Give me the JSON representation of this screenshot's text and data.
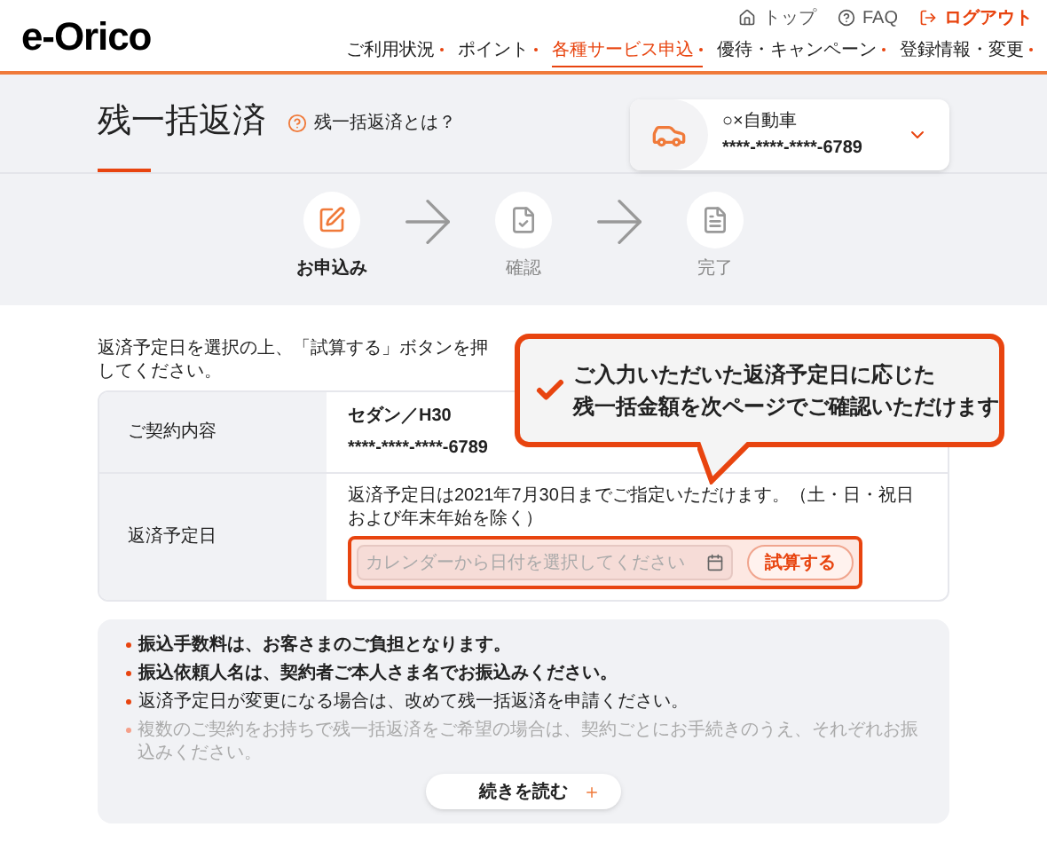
{
  "header": {
    "logo": "e-Orico",
    "utility_links": [
      {
        "kind": "home",
        "label": "トップ"
      },
      {
        "kind": "help",
        "label": "FAQ"
      },
      {
        "kind": "logout",
        "label": "ログアウト"
      }
    ],
    "nav": [
      {
        "label": "ご利用状況",
        "selected": false
      },
      {
        "label": "ポイント",
        "selected": false
      },
      {
        "label": "各種サービス申込",
        "selected": true
      },
      {
        "label": "優待・キャンペーン",
        "selected": false
      },
      {
        "label": "登録情報・変更",
        "selected": false
      }
    ]
  },
  "hero": {
    "title": "残一括返済",
    "help_link": "残一括返済とは？",
    "card": {
      "name": "○×自動車",
      "number": "****-****-****-6789"
    }
  },
  "steps": [
    {
      "label": "お申込み",
      "kind": "apply",
      "selected": true
    },
    {
      "label": "確認",
      "kind": "confirm",
      "selected": false
    },
    {
      "label": "完了",
      "kind": "done",
      "selected": false
    }
  ],
  "instruction": "返済予定日を選択の上、「試算する」ボタンを押してください。",
  "callout": {
    "lines": [
      "ご入力いただいた返済予定日に応じた",
      "残一括金額を次ページでご確認いただけます"
    ]
  },
  "table": {
    "rows": [
      {
        "kind": "contract",
        "label": "ご契約内容",
        "lines": [
          "セダン／H30",
          "****-****-****-6789"
        ]
      },
      {
        "kind": "date",
        "label": "返済予定日",
        "note": "返済予定日は2021年7月30日までご指定いただけます。（土・日・祝日および年末年始を除く）",
        "placeholder": "カレンダーから日付を選択してください",
        "button": "試算する"
      }
    ]
  },
  "notes": {
    "items": [
      "振込手数料は、お客さまのご負担となります。",
      "振込依頼人名は、契約者ご本人さま名でお振込みください。",
      "返済予定日が変更になる場合は、改めて残一括返済を申請ください。",
      "複数のご契約をお持ちで残一括返済をご希望の場合は、契約ごとにお手続きのうえ、それぞれお振込みください。"
    ],
    "more_button": "続きを読む"
  }
}
